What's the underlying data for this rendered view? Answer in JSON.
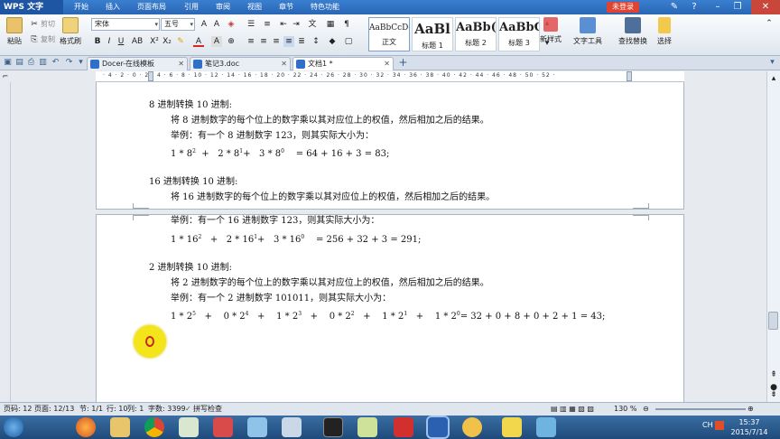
{
  "menubar": {
    "app": "WPS 文字",
    "items": [
      "开始",
      "插入",
      "页面布局",
      "引用",
      "审阅",
      "视图",
      "章节",
      "特色功能"
    ],
    "login": "未登录"
  },
  "ribbon": {
    "paste": "粘贴",
    "cut": "剪切",
    "copy": "复制",
    "format_painter": "格式刷",
    "font": "宋体",
    "size": "五号",
    "styles": [
      {
        "preview": "AaBbCcDd",
        "name": "正文"
      },
      {
        "preview": "AaBl",
        "name": "标题 1"
      },
      {
        "preview": "AaBb(",
        "name": "标题 2"
      },
      {
        "preview": "AaBbC",
        "name": "标题 3"
      }
    ],
    "new_style": "新样式",
    "text_tools": "文字工具",
    "find_replace": "查找替换",
    "select": "选择"
  },
  "tabs": [
    {
      "label": "Docer-在线模板",
      "color": "#2f6fc7"
    },
    {
      "label": "笔记3.doc",
      "color": "#2f6fc7"
    },
    {
      "label": "文档1 *",
      "color": "#2f6fc7"
    }
  ],
  "doc": {
    "lines_top": [
      {
        "text": "8 进制转换 10 进制:",
        "indent": false
      },
      {
        "text": "将 8 进制数字的每个位上的数字乘以其对应位上的权值，然后相加之后的结果。",
        "indent": true
      },
      {
        "text": "举例：有一个 8 进制数字 123，则其实际大小为：",
        "indent": true
      }
    ],
    "formula8": {
      "a": "1 * 8",
      "ae": "2",
      "b": "2 * 8",
      "be": "1",
      "c": "3 * 8",
      "ce": "0",
      "result": "=    64 + 16 + 3 = 83;"
    },
    "lines_top2": [
      {
        "text": "16 进制转换 10 进制:",
        "indent": false
      },
      {
        "text": "将 16 进制数字的每个位上的数字乘以其对应位上的权值，然后相加之后的结果。",
        "indent": true
      }
    ],
    "lines_bot": [
      {
        "text": "举例：有一个 16 进制数字 123，则其实际大小为：",
        "indent": true
      }
    ],
    "formula16": {
      "a": "1 * 16",
      "ae": "2",
      "b": "2 * 16",
      "be": "1",
      "c": "3 * 16",
      "ce": "0",
      "result": "=    256 + 32 + 3 = 291;"
    },
    "lines_bot2": [
      {
        "text": "2 进制转换 10 进制:",
        "indent": false
      },
      {
        "text": "将 2 进制数字的每个位上的数字乘以其对应位上的权值，然后相加之后的结果。",
        "indent": true
      },
      {
        "text": "举例：有一个 2 进制数字 101011，则其实际大小为：",
        "indent": true
      }
    ],
    "formula2": {
      "terms": [
        {
          "base": "1 * 2",
          "exp": "5"
        },
        {
          "base": "0 * 2",
          "exp": "4"
        },
        {
          "base": "1 * 2",
          "exp": "3"
        },
        {
          "base": "0 * 2",
          "exp": "2"
        },
        {
          "base": "1 * 2",
          "exp": "1"
        },
        {
          "base": "1 * 2",
          "exp": "0"
        }
      ],
      "result": "=    32 + 0 + 8 + 0 + 2 + 1 = 43;"
    }
  },
  "status": {
    "page": "页码: 12",
    "pages": "页面: 12/13",
    "section": "节: 1/1",
    "row": "行: 10",
    "col": "列: 1",
    "words": "字数: 3399",
    "spell": "拼写检查",
    "zoom": "130 %"
  },
  "clock": {
    "time": "15:37",
    "date": "2015/7/14"
  },
  "tray": {
    "lang": "CH"
  }
}
